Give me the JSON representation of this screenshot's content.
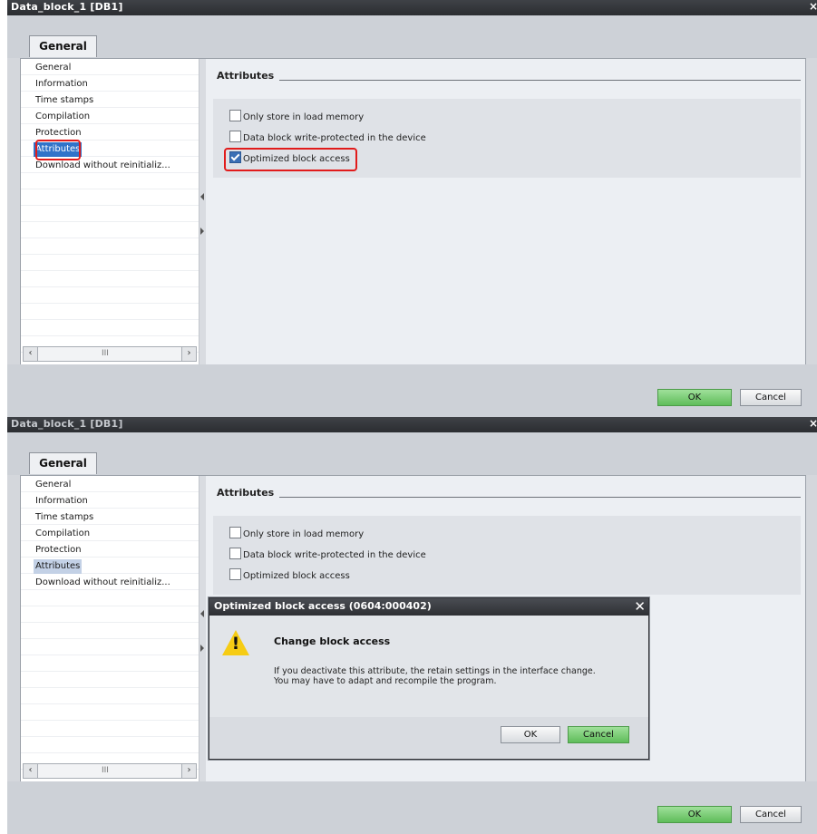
{
  "top_panel": {
    "window_title": "Data_block_1 [DB1]",
    "tab_label": "General",
    "nav_items": [
      "General",
      "Information",
      "Time stamps",
      "Compilation",
      "Protection",
      "Attributes",
      "Download without reinitializ..."
    ],
    "selected_nav": "Attributes",
    "section_heading": "Attributes",
    "checkboxes": [
      {
        "label": "Only store in load memory",
        "checked": false
      },
      {
        "label": "Data block write-protected in the device",
        "checked": false
      },
      {
        "label": "Optimized block access",
        "checked": true
      }
    ],
    "ok_label": "OK",
    "cancel_label": "Cancel",
    "scroll_grip": "III"
  },
  "bottom_panel": {
    "window_title": "Data_block_1 [DB1]",
    "tab_label": "General",
    "nav_items": [
      "General",
      "Information",
      "Time stamps",
      "Compilation",
      "Protection",
      "Attributes",
      "Download without reinitializ..."
    ],
    "selected_nav": "Attributes",
    "section_heading": "Attributes",
    "checkboxes": [
      {
        "label": "Only store in load memory",
        "checked": false
      },
      {
        "label": "Data block write-protected in the device",
        "checked": false
      },
      {
        "label": "Optimized block access",
        "checked": false
      }
    ],
    "ok_label": "OK",
    "cancel_label": "Cancel",
    "scroll_grip": "III",
    "dialog": {
      "title": "Optimized block access (0604:000402)",
      "close_glyph": "✕",
      "heading": "Change block access",
      "message_line1": "If you deactivate this attribute, the retain settings in the interface change.",
      "message_line2": "You may have to adapt and recompile the program.",
      "ok_label": "OK",
      "cancel_label": "Cancel",
      "warning_mark": "!"
    }
  },
  "colors": {
    "highlight": "#e11b1b",
    "selected_nav": "#3173c9",
    "ok_button": "#6cc866",
    "warning": "#f6cc14"
  },
  "icons": [
    "checkbox-icon",
    "warning-icon",
    "close-icon",
    "scroll-left-icon",
    "scroll-right-icon"
  ]
}
